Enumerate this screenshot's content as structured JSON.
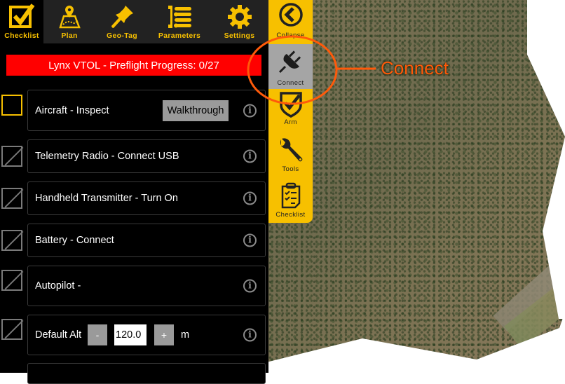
{
  "toolbar": {
    "tabs": [
      {
        "label": "Checklist",
        "icon": "checkbox-icon",
        "active": true
      },
      {
        "label": "Plan",
        "icon": "map-pin-icon",
        "active": false
      },
      {
        "label": "Geo-Tag",
        "icon": "pushpin-icon",
        "active": false
      },
      {
        "label": "Parameters",
        "icon": "tree-list-icon",
        "active": false
      },
      {
        "label": "Settings",
        "icon": "gear-icon",
        "active": false
      }
    ]
  },
  "banner": {
    "text": "Lynx VTOL -  Preflight Progress: 0/27",
    "color": "#ff0000"
  },
  "checklist": {
    "items": [
      {
        "label": "Aircraft - Inspect",
        "action": "Walkthrough",
        "state": "active"
      },
      {
        "label": "Telemetry Radio - Connect USB",
        "state": "disabled"
      },
      {
        "label": "Handheld Transmitter - Turn On",
        "state": "disabled"
      },
      {
        "label": "Battery - Connect",
        "state": "disabled"
      },
      {
        "label": "Autopilot -",
        "state": "disabled"
      },
      {
        "label": "Default Alt",
        "state": "disabled",
        "minus": "-",
        "value": "120.0",
        "plus": "+",
        "unit": "m"
      }
    ],
    "info_glyph": "i"
  },
  "sidebar": {
    "accent": "#f7c000",
    "items": [
      {
        "label": "Collapse",
        "icon": "chevron-left-circle-icon"
      },
      {
        "label": "Connect",
        "icon": "plug-icon",
        "active": true
      },
      {
        "label": "Arm",
        "icon": "shield-check-icon"
      },
      {
        "label": "Tools",
        "icon": "wrench-icon"
      },
      {
        "label": "Checklist",
        "icon": "clipboard-icon"
      }
    ]
  },
  "callout": {
    "text": "Connect",
    "color": "#ff5a0a"
  }
}
